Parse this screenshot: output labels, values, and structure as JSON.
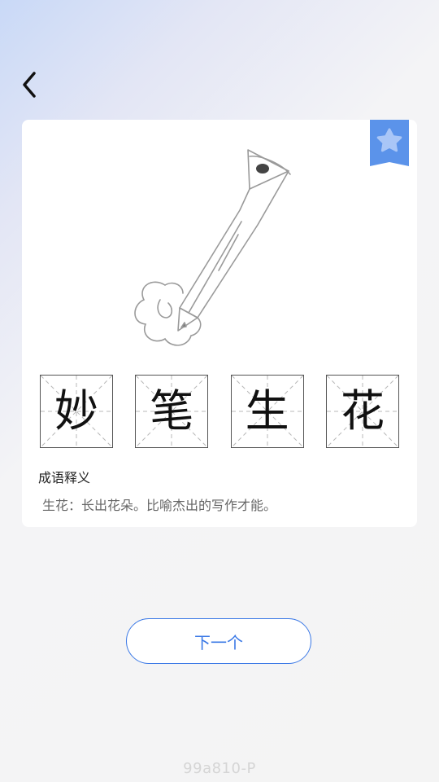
{
  "header": {
    "back_icon": "chevron-left-icon"
  },
  "card": {
    "favorite_icon": "star-bookmark-icon",
    "illustration": "pencil-drawing-flower",
    "idiom_chars": [
      "妙",
      "笔",
      "生",
      "花"
    ],
    "meaning_title": "成语释义",
    "meaning_text": "生花：长出花朵。比喻杰出的写作才能。"
  },
  "footer": {
    "next_label": "下一个"
  },
  "watermark": "99a810-P",
  "colors": {
    "accent": "#3a78e6",
    "badge": "#5b93ea",
    "star": "#a9c6f7"
  }
}
